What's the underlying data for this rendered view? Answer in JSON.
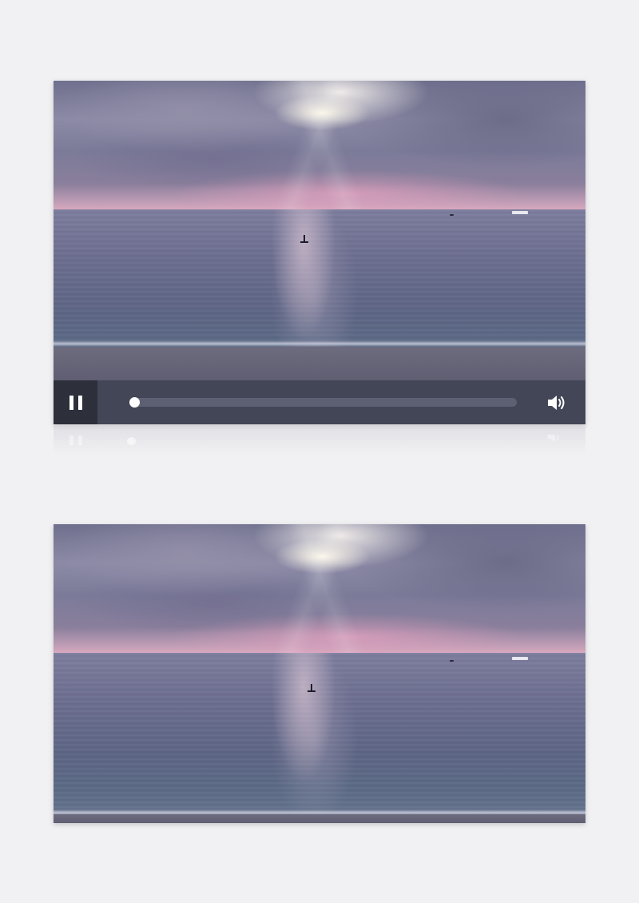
{
  "player": {
    "controls": {
      "play_state": "playing",
      "play_button_icon": "pause-icon",
      "progress_fraction": 0.0,
      "volume_icon": "volume-icon",
      "colors": {
        "control_bar": "#434657",
        "play_button_bg": "#2d2f3a",
        "track": "#5d6072",
        "knob": "#ffffff"
      }
    },
    "video_frame": {
      "icon": "video-frame-image"
    }
  },
  "preview_frame": {
    "icon": "video-frame-image"
  },
  "page": {
    "background": "#f1f1f3"
  }
}
